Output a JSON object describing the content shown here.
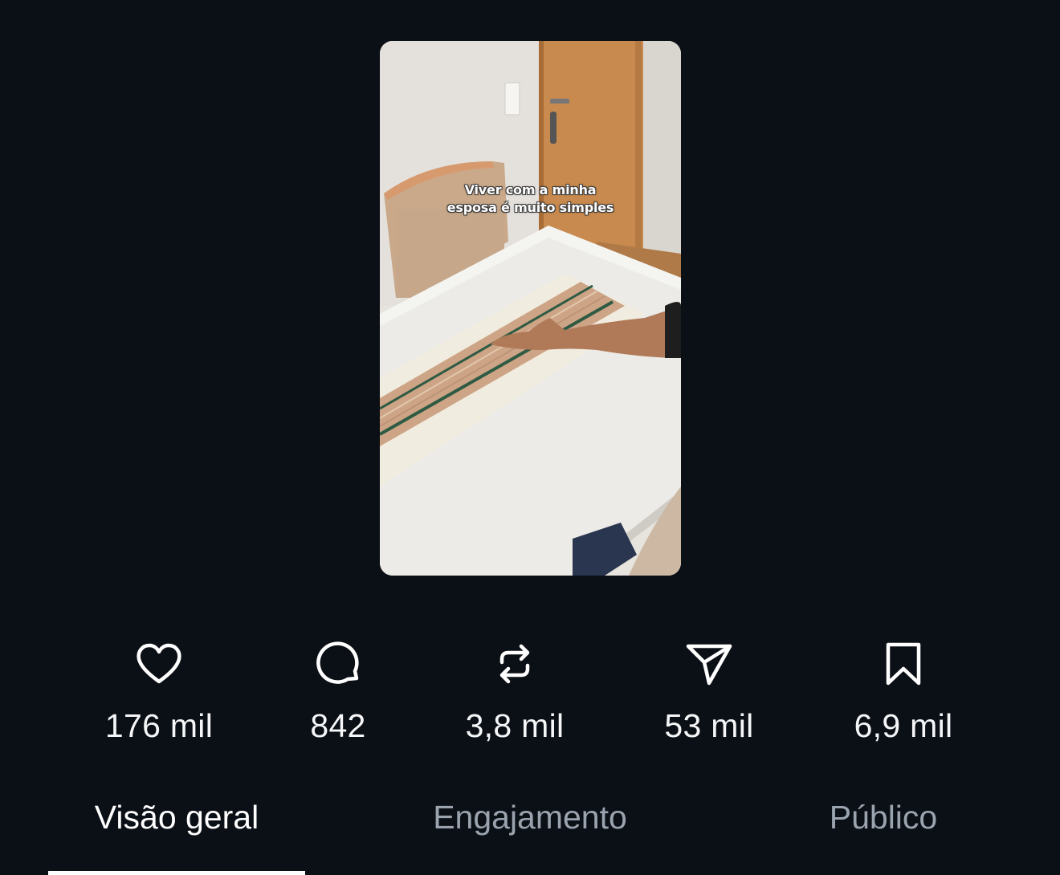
{
  "video": {
    "caption_line1": "Viver com a minha",
    "caption_line2": "esposa é muito simples"
  },
  "metrics": [
    {
      "icon": "heart-icon",
      "value": "176 mil"
    },
    {
      "icon": "comment-icon",
      "value": "842"
    },
    {
      "icon": "repost-icon",
      "value": "3,8 mil"
    },
    {
      "icon": "send-icon",
      "value": "53 mil"
    },
    {
      "icon": "bookmark-icon",
      "value": "6,9 mil"
    }
  ],
  "tabs": [
    {
      "label": "Visão geral",
      "active": true
    },
    {
      "label": "Engajamento",
      "active": false
    },
    {
      "label": "Público",
      "active": false
    }
  ],
  "colors": {
    "background": "#0b0f16",
    "text_active": "#ffffff",
    "text_inactive": "#9aa3ae"
  }
}
